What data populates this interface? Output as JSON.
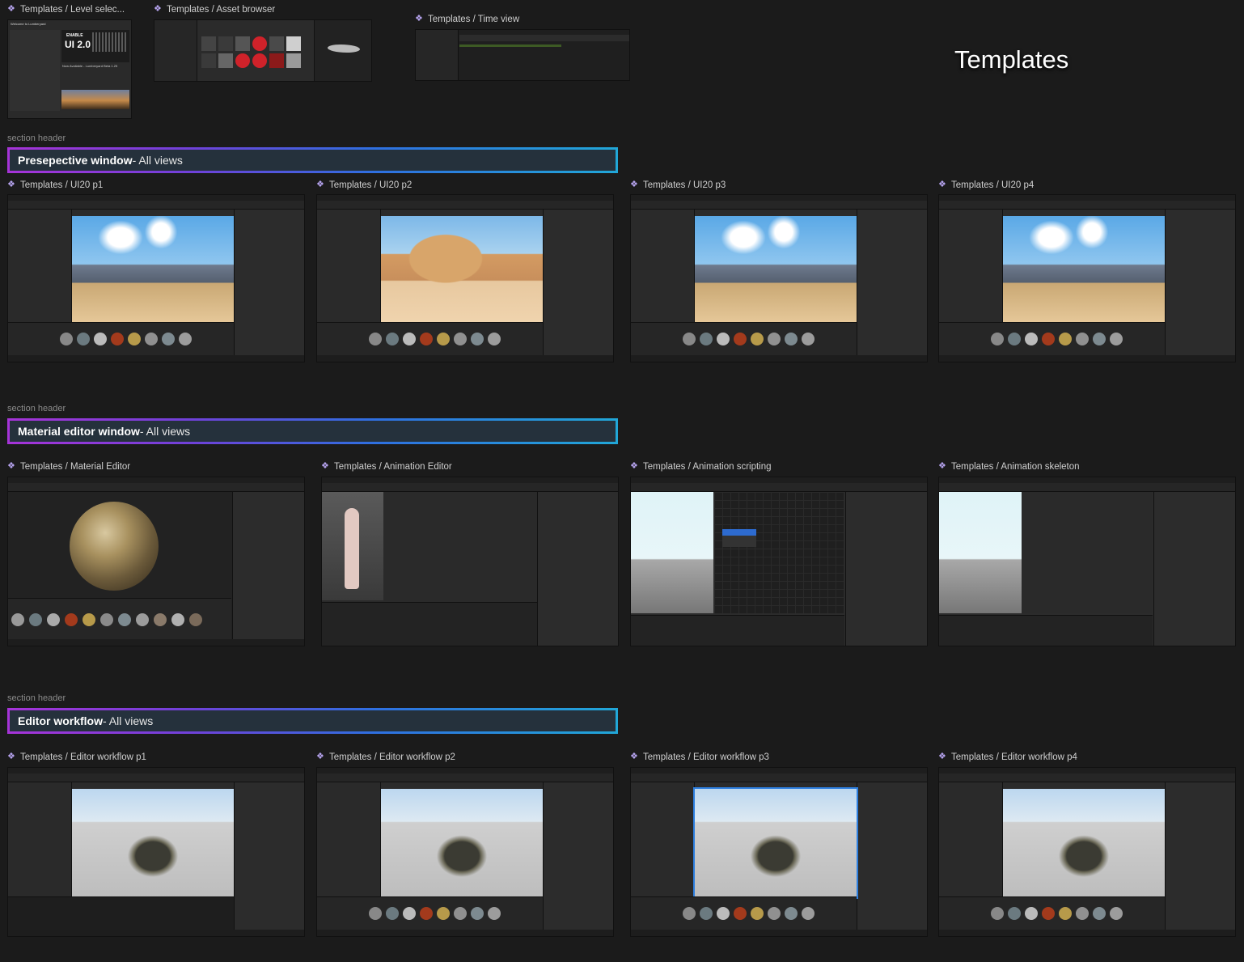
{
  "page_title": "Templates",
  "frames": {
    "level_select": "Templates / Level selec...",
    "asset_browser": "Templates / Asset browser",
    "time_view": "Templates / Time view",
    "ui20_p1": "Templates / UI20 p1",
    "ui20_p2": "Templates / UI20 p2",
    "ui20_p3": "Templates / UI20 p3",
    "ui20_p4": "Templates / UI20 p4",
    "material_editor": "Templates / Material Editor",
    "animation_editor": "Templates / Animation Editor",
    "animation_scripting": "Templates / Animation scripting",
    "animation_skeleton": "Templates / Animation skeleton",
    "workflow_p1": "Templates / Editor workflow p1",
    "workflow_p2": "Templates / Editor workflow p2",
    "workflow_p3": "Templates / Editor workflow p3",
    "workflow_p4": "Templates / Editor workflow p4"
  },
  "sections": [
    {
      "header_label": "section header",
      "title": "Presepective window",
      "subtitle": " - All views"
    },
    {
      "header_label": "section header",
      "title": "Material editor window",
      "subtitle": " - All views"
    },
    {
      "header_label": "section header",
      "title": "Editor workflow",
      "subtitle": "- All views"
    }
  ],
  "level_select": {
    "welcome": "Welcome to Lumberyard",
    "badge_top": "ENABLE",
    "badge_main": "UI 2.0",
    "headline": "Now Available - Lumberyard Beta 1.25"
  },
  "colors": {
    "background": "#1b1b1b",
    "label_text": "#cfcfcf",
    "component_icon": "#b7a4f0",
    "section_gradient_start": "#a733d8",
    "section_gradient_end": "#21a7d8",
    "section_fill": "#25313c"
  }
}
